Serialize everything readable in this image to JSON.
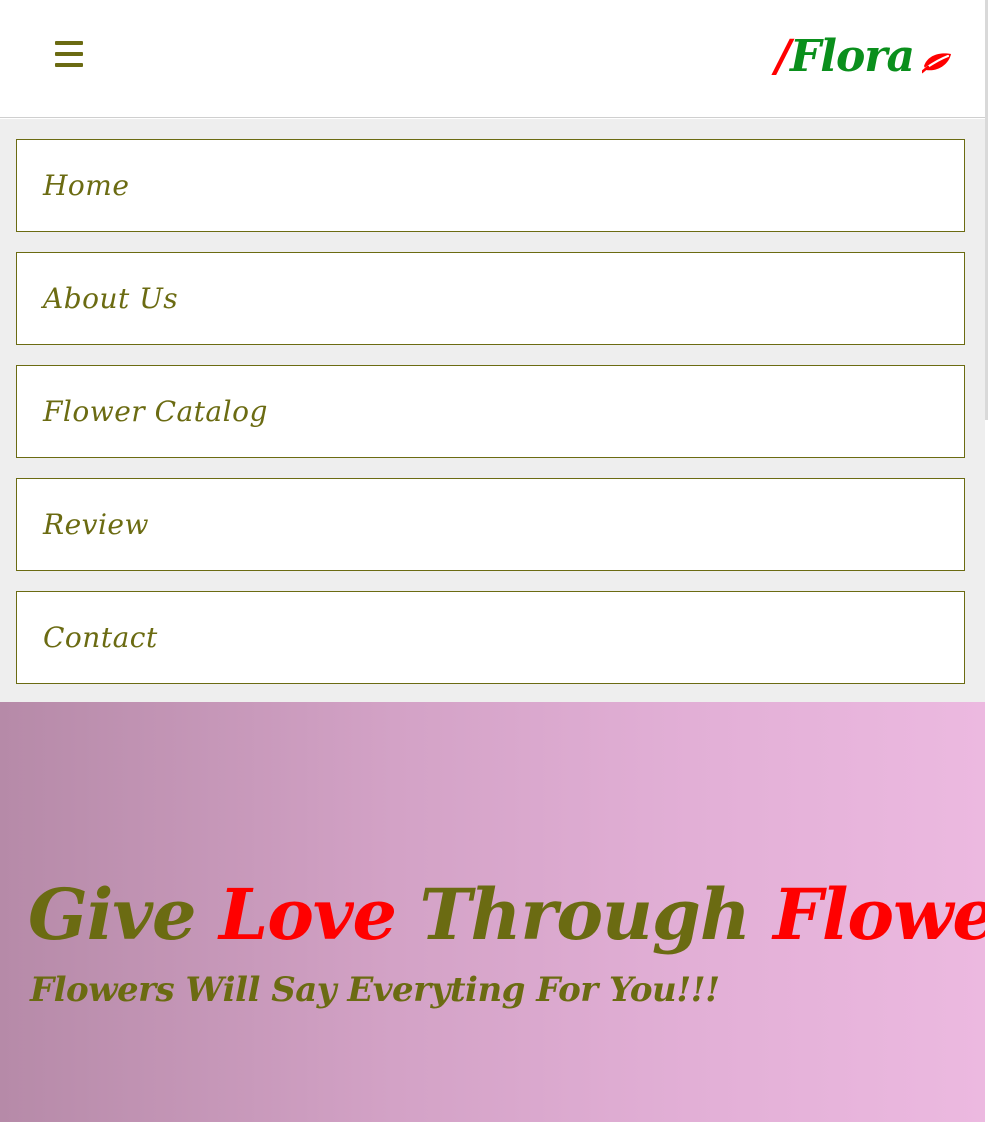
{
  "header": {
    "menu_icon": "hamburger-menu-icon",
    "logo": {
      "slash": "/",
      "name": "Flora",
      "icon": "leaf-icon"
    }
  },
  "menu": {
    "items": [
      {
        "label": "Home"
      },
      {
        "label": "About Us"
      },
      {
        "label": "Flower Catalog"
      },
      {
        "label": "Review"
      },
      {
        "label": "Contact"
      }
    ]
  },
  "hero": {
    "title": {
      "word1": "Give",
      "word2": "Love",
      "word3": "Through",
      "word4": "Flowers!"
    },
    "subtitle": "Flowers Will Say Everyting For You!!!"
  },
  "colors": {
    "accent_olive": "#6b6b12",
    "accent_red": "#ff0000",
    "logo_green": "#0a8f1c",
    "menu_background": "#eeeeee",
    "hero_gradient_start": "#b68aa8",
    "hero_gradient_end": "#ecb9e0"
  }
}
